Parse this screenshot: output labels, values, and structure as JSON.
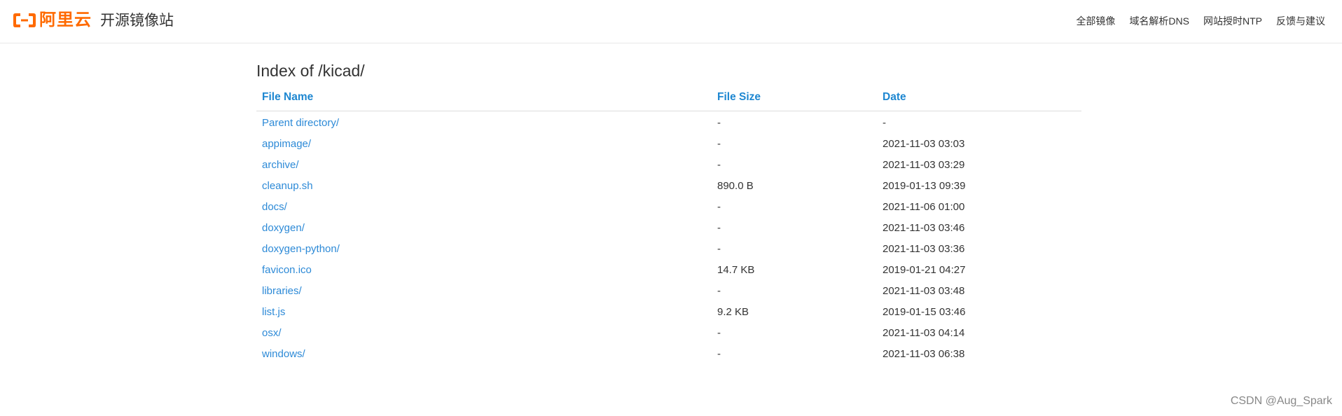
{
  "header": {
    "logo_text": "阿里云",
    "site_title": "开源镜像站",
    "nav": [
      {
        "label": "全部镜像"
      },
      {
        "label": "域名解析DNS"
      },
      {
        "label": "网站授时NTP"
      },
      {
        "label": "反馈与建议"
      }
    ],
    "brand_color": "#ff6a00"
  },
  "page": {
    "title": "Index of /kicad/",
    "columns": {
      "name": "File Name",
      "size": "File Size",
      "date": "Date"
    },
    "rows": [
      {
        "name": "Parent directory/",
        "size": "-",
        "date": "-"
      },
      {
        "name": "appimage/",
        "size": "-",
        "date": "2021-11-03 03:03"
      },
      {
        "name": "archive/",
        "size": "-",
        "date": "2021-11-03 03:29"
      },
      {
        "name": "cleanup.sh",
        "size": "890.0 B",
        "date": "2019-01-13 09:39"
      },
      {
        "name": "docs/",
        "size": "-",
        "date": "2021-11-06 01:00"
      },
      {
        "name": "doxygen/",
        "size": "-",
        "date": "2021-11-03 03:46"
      },
      {
        "name": "doxygen-python/",
        "size": "-",
        "date": "2021-11-03 03:36"
      },
      {
        "name": "favicon.ico",
        "size": "14.7 KB",
        "date": "2019-01-21 04:27"
      },
      {
        "name": "libraries/",
        "size": "-",
        "date": "2021-11-03 03:48"
      },
      {
        "name": "list.js",
        "size": "9.2 KB",
        "date": "2019-01-15 03:46"
      },
      {
        "name": "osx/",
        "size": "-",
        "date": "2021-11-03 04:14"
      },
      {
        "name": "windows/",
        "size": "-",
        "date": "2021-11-03 06:38"
      }
    ],
    "link_color": "#2d8ad7",
    "header_color": "#1e87d1"
  },
  "watermark": "CSDN @Aug_Spark"
}
